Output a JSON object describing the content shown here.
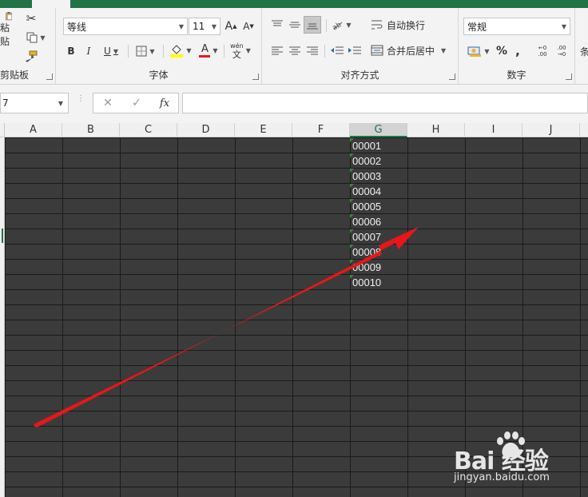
{
  "ribbon": {
    "clipboard": {
      "paste_label": "粘贴",
      "group_label": "剪贴板"
    },
    "font": {
      "font_name": "等线",
      "font_size": "11",
      "grow_font": "A",
      "shrink_font": "A",
      "bold": "B",
      "italic": "I",
      "underline": "U",
      "font_color_letter": "A",
      "phonetic_top": "wén",
      "phonetic_bottom": "文",
      "group_label": "字体"
    },
    "alignment": {
      "wrap_text": "自动换行",
      "merge_center": "合并后居中",
      "group_label": "对齐方式"
    },
    "number": {
      "format": "常规",
      "percent": "%",
      "comma": ",",
      "inc_decimal": "←0 .00",
      "dec_decimal": ".00 →0",
      "group_label": "数字"
    },
    "next_group_partial": "条"
  },
  "formula_bar": {
    "name_box": "7",
    "cancel": "✕",
    "enter": "✓",
    "fx": "fx",
    "formula": ""
  },
  "sheet": {
    "columns": [
      "A",
      "B",
      "C",
      "D",
      "E",
      "F",
      "G",
      "H",
      "I",
      "J"
    ],
    "selected_column": "G",
    "column_g_values": [
      "00001",
      "00002",
      "00003",
      "00004",
      "00005",
      "00006",
      "00007",
      "00008",
      "00009",
      "00010"
    ]
  },
  "annotation": {
    "arrow_color": "#e8161a"
  },
  "watermark": {
    "brand": "Bai 经验",
    "url": "jingyan.baidu.com"
  },
  "colors": {
    "excel_green": "#217346",
    "cell_dark": "#3b3b3b",
    "gridline": "#1b1b1b"
  }
}
